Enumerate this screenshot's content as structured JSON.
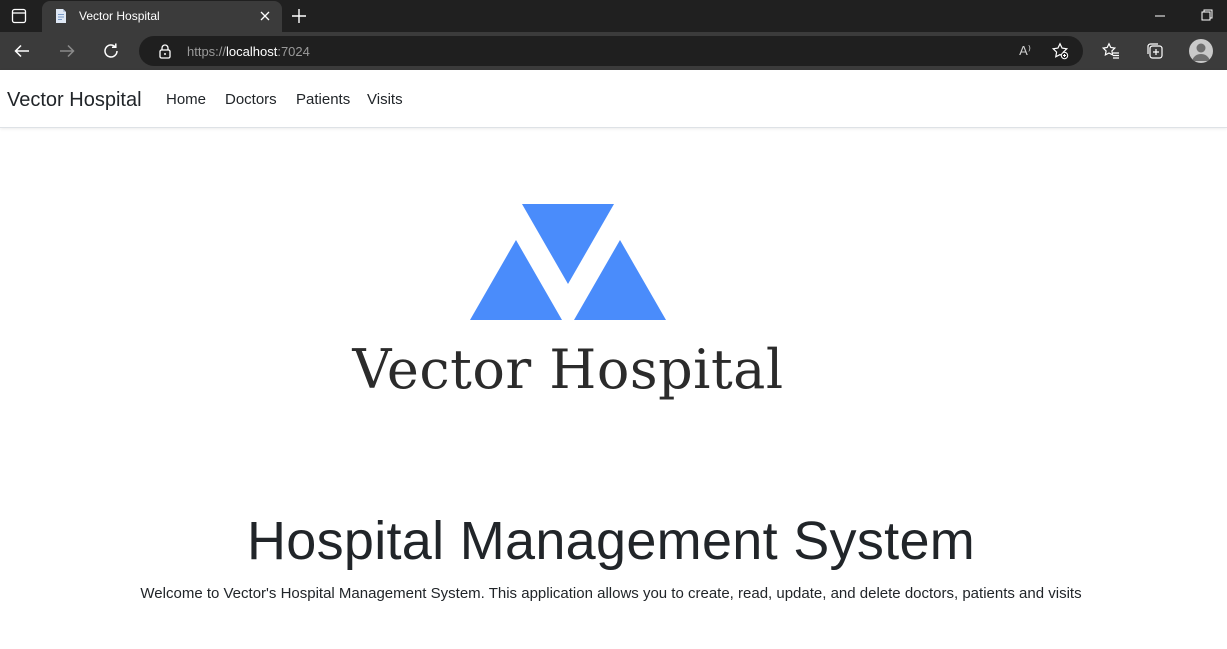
{
  "browser": {
    "tab": {
      "title": "Vector Hospital"
    },
    "address": {
      "scheme": "https://",
      "host": "localhost",
      "port": ":7024"
    },
    "read_aloud_label": "A⁾"
  },
  "navbar": {
    "brand": "Vector Hospital",
    "links": [
      {
        "label": "Home"
      },
      {
        "label": "Doctors"
      },
      {
        "label": "Patients"
      },
      {
        "label": "Visits"
      }
    ]
  },
  "hero": {
    "logo_text": "Vector Hospital",
    "logo_color": "#4a8cfb",
    "title": "Hospital Management System",
    "welcome": "Welcome to Vector's Hospital Management System. This application allows you to create, read, update, and delete doctors, patients and visits"
  }
}
